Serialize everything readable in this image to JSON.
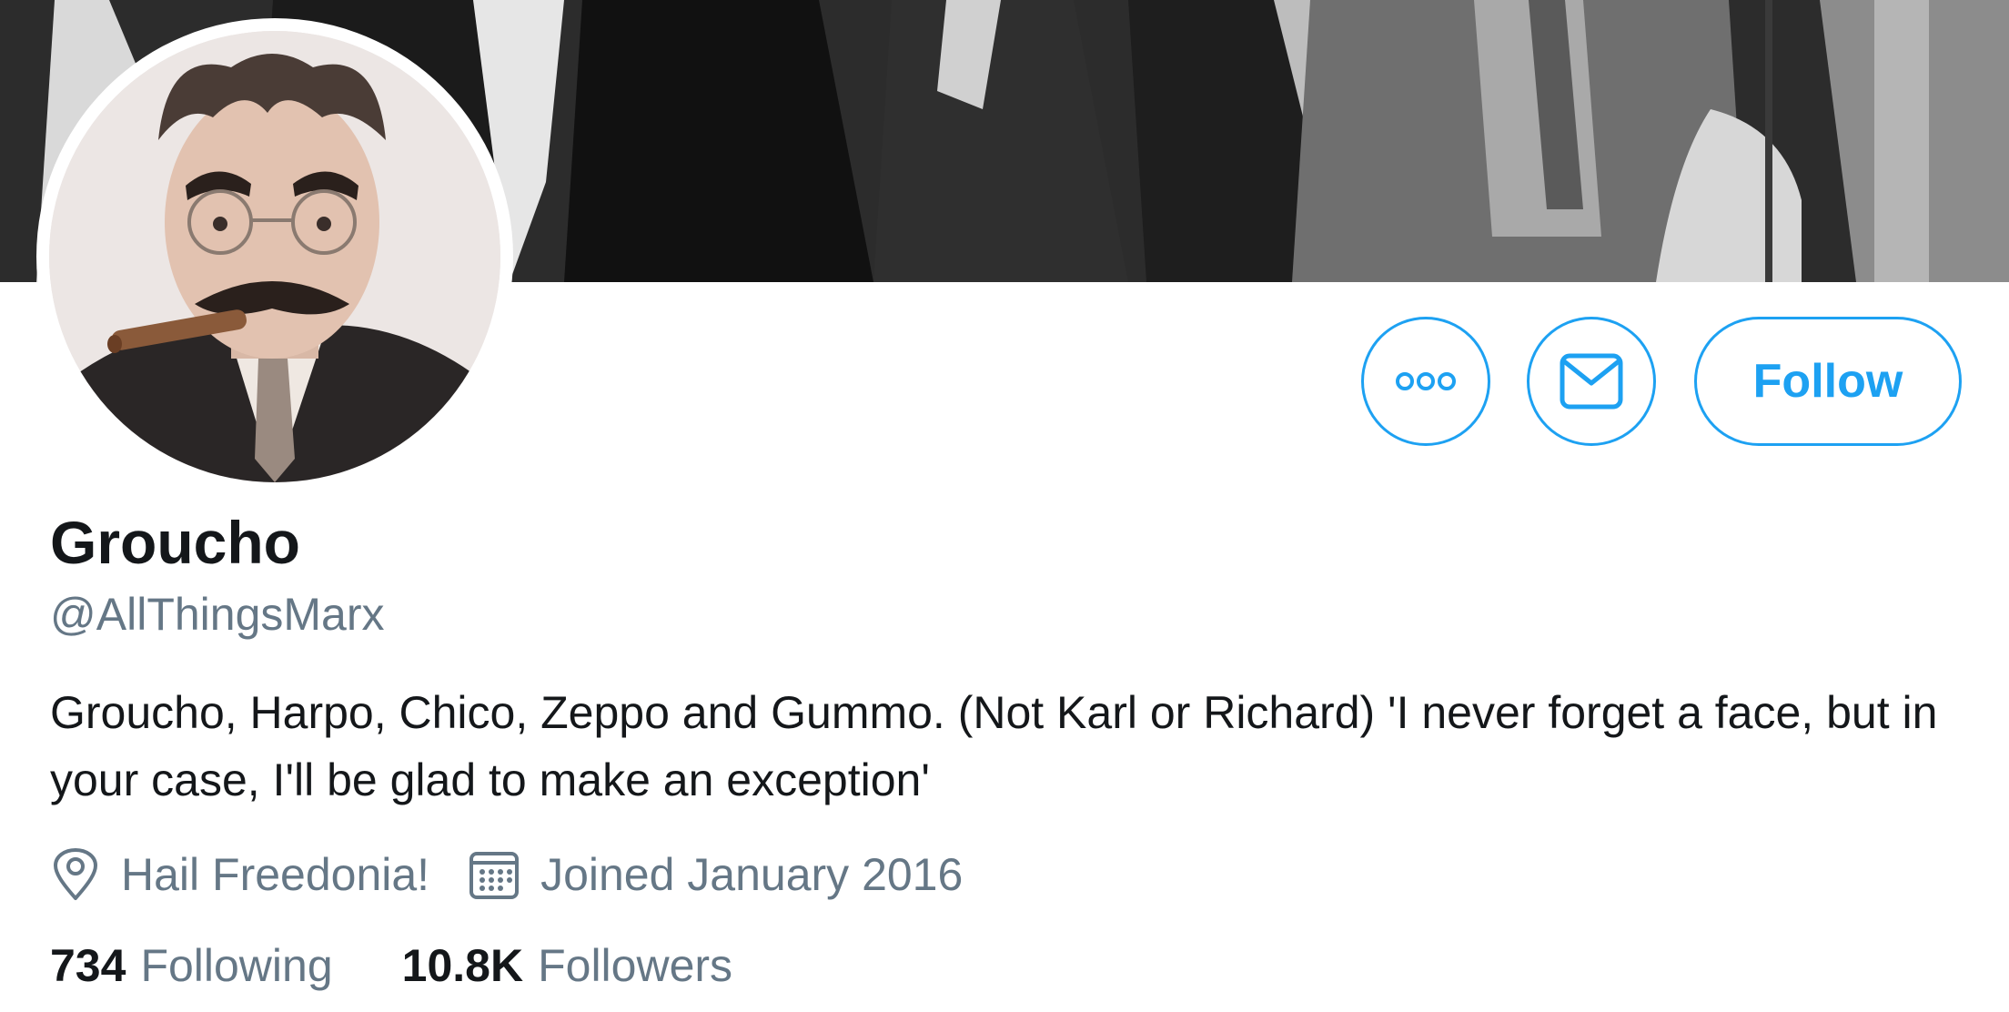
{
  "profile": {
    "display_name": "Groucho",
    "handle": "@AllThingsMarx",
    "bio": "Groucho, Harpo, Chico, Zeppo and Gummo. (Not Karl or Richard) 'I never forget a face, but in your case, I'll be glad to make an exception'",
    "location": "Hail Freedonia!",
    "joined": "Joined January 2016"
  },
  "actions": {
    "follow_label": "Follow"
  },
  "stats": {
    "following_count": "734",
    "following_label": "Following",
    "followers_count": "10.8K",
    "followers_label": "Followers"
  },
  "icons": {
    "more": "more-icon",
    "mail": "mail-icon",
    "location": "location-pin-icon",
    "calendar": "calendar-icon"
  },
  "colors": {
    "accent": "#1da1f2",
    "text_primary": "#14171a",
    "text_secondary": "#657786"
  }
}
